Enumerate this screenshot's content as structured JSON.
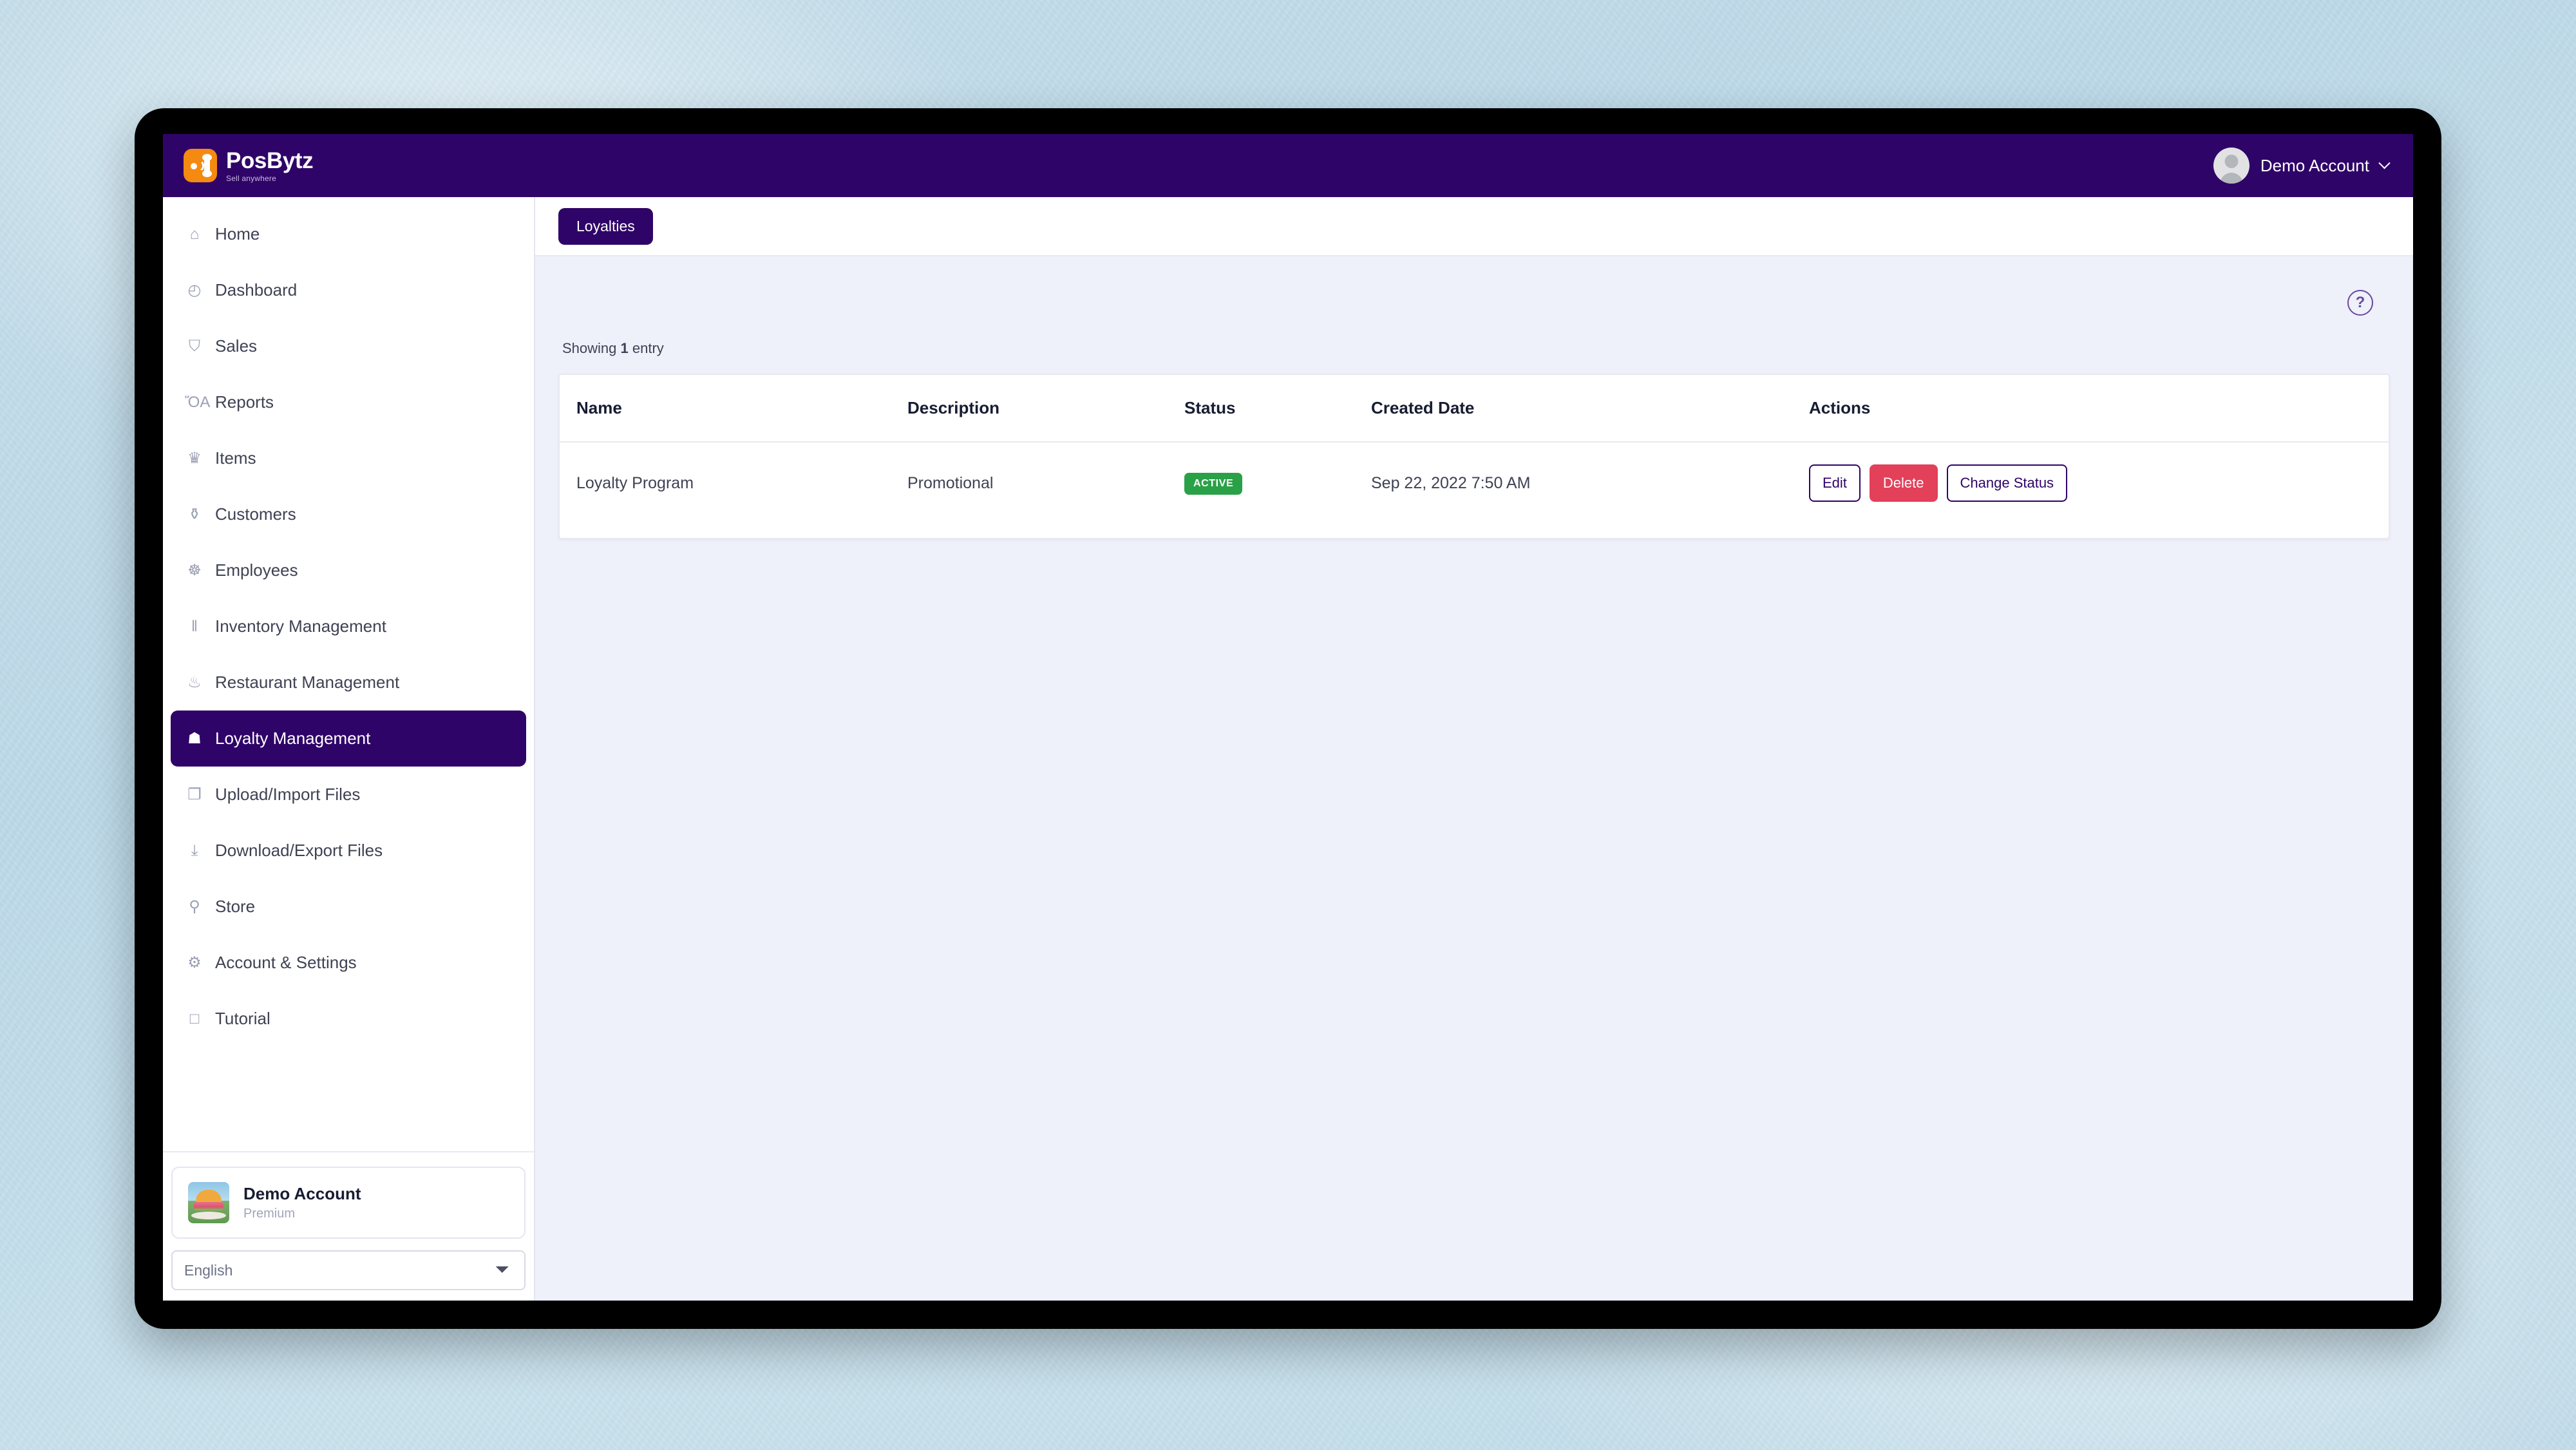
{
  "brand": {
    "name": "PosBytz",
    "tagline": "Sell anywhere",
    "logo_icon": "posbytz-logo-icon",
    "header_color": "#2F0468",
    "logo_bg_color": "#F58A10"
  },
  "topbar": {
    "account_name": "Demo Account",
    "avatar_icon": "user-avatar-icon",
    "chevron_icon": "chevron-down-icon"
  },
  "sidebar": {
    "items": [
      {
        "label": "Home",
        "icon": "home-icon",
        "glyph": "⌂",
        "active": false
      },
      {
        "label": "Dashboard",
        "icon": "dashboard-clock-icon",
        "glyph": "◴",
        "active": false
      },
      {
        "label": "Sales",
        "icon": "shopping-cart-icon",
        "glyph": "Ὥ2",
        "active": false
      },
      {
        "label": "Reports",
        "icon": "bar-chart-icon",
        "glyph": "ὌA",
        "active": false
      },
      {
        "label": "Items",
        "icon": "items-crown-icon",
        "glyph": "♛",
        "active": false
      },
      {
        "label": "Customers",
        "icon": "customers-people-icon",
        "glyph": "⚱",
        "active": false
      },
      {
        "label": "Employees",
        "icon": "employees-icon",
        "glyph": "☸",
        "active": false
      },
      {
        "label": "Inventory Management",
        "icon": "inventory-bars-icon",
        "glyph": "▐",
        "active": false
      },
      {
        "label": "Restaurant Management",
        "icon": "restaurant-cutlery-icon",
        "glyph": "ἷ4",
        "active": false
      },
      {
        "label": "Loyalty Management",
        "icon": "loyalty-gift-icon",
        "glyph": "Ἰ1",
        "active": true
      },
      {
        "label": "Upload/Import Files",
        "icon": "upload-files-icon",
        "glyph": "❐",
        "active": false
      },
      {
        "label": "Download/Export Files",
        "icon": "download-files-icon",
        "glyph": "⤓",
        "active": false
      },
      {
        "label": "Store",
        "icon": "store-location-pin-icon",
        "glyph": "⚲",
        "active": false
      },
      {
        "label": "Account & Settings",
        "icon": "gear-icon",
        "glyph": "⚙",
        "active": false
      },
      {
        "label": "Tutorial",
        "icon": "tutorial-book-icon",
        "glyph": "▢",
        "active": false
      }
    ],
    "active_bg_color": "#2F0468",
    "user_card": {
      "name": "Demo Account",
      "plan": "Premium",
      "thumb_icon": "burger-store-thumbnail"
    },
    "language": {
      "selected": "English",
      "options": [
        "English"
      ]
    }
  },
  "content": {
    "tab": {
      "label": "Loyalties"
    },
    "help_icon": "help-circle-icon",
    "showing_prefix": "Showing",
    "showing_count": "1",
    "showing_suffix": "entry",
    "table": {
      "columns": [
        "Name",
        "Description",
        "Status",
        "Created Date",
        "Actions"
      ],
      "rows": [
        {
          "name": "Loyalty Program",
          "description": "Promotional",
          "status": "ACTIVE",
          "status_color": "#2AA147",
          "created_date": "Sep 22, 2022 7:50 AM",
          "actions": [
            {
              "label": "Edit",
              "style": "outline"
            },
            {
              "label": "Delete",
              "style": "danger"
            },
            {
              "label": "Change Status",
              "style": "outline"
            }
          ]
        }
      ]
    }
  }
}
